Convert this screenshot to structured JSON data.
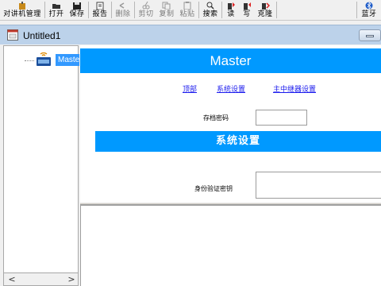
{
  "toolbar": {
    "buttons": [
      {
        "label": "对讲机管理",
        "icon": "radio-manage-icon"
      },
      {
        "label": "打开",
        "icon": "open-folder-icon"
      },
      {
        "label": "保存",
        "icon": "save-icon"
      },
      {
        "label": "报告",
        "icon": "report-icon"
      },
      {
        "label": "删除",
        "icon": "delete-icon"
      },
      {
        "label": "剪切",
        "icon": "cut-icon"
      },
      {
        "label": "复制",
        "icon": "copy-icon"
      },
      {
        "label": "粘贴",
        "icon": "paste-icon"
      },
      {
        "label": "搜索",
        "icon": "search-icon"
      },
      {
        "label": "读",
        "icon": "read-icon"
      },
      {
        "label": "写",
        "icon": "write-icon"
      },
      {
        "label": "克隆",
        "icon": "clone-icon"
      },
      {
        "label": "蓝牙",
        "icon": "bluetooth-icon"
      }
    ]
  },
  "window": {
    "title": "Untitled1"
  },
  "tree": {
    "root_label": "Master"
  },
  "content": {
    "banner": "Master",
    "links": [
      "顶部",
      "系统设置",
      "主中继器设置"
    ],
    "archive_password_label": "存档密码",
    "archive_password_value": "",
    "section_title": "系统设置",
    "auth_key_label": "身份验证密钥",
    "auth_key_value": ""
  },
  "colors": {
    "banner_blue": "#0099ff",
    "tree_select_blue": "#3399ff",
    "link_blue": "#1a1aee",
    "titlebar_bg": "#bcd2ea"
  }
}
